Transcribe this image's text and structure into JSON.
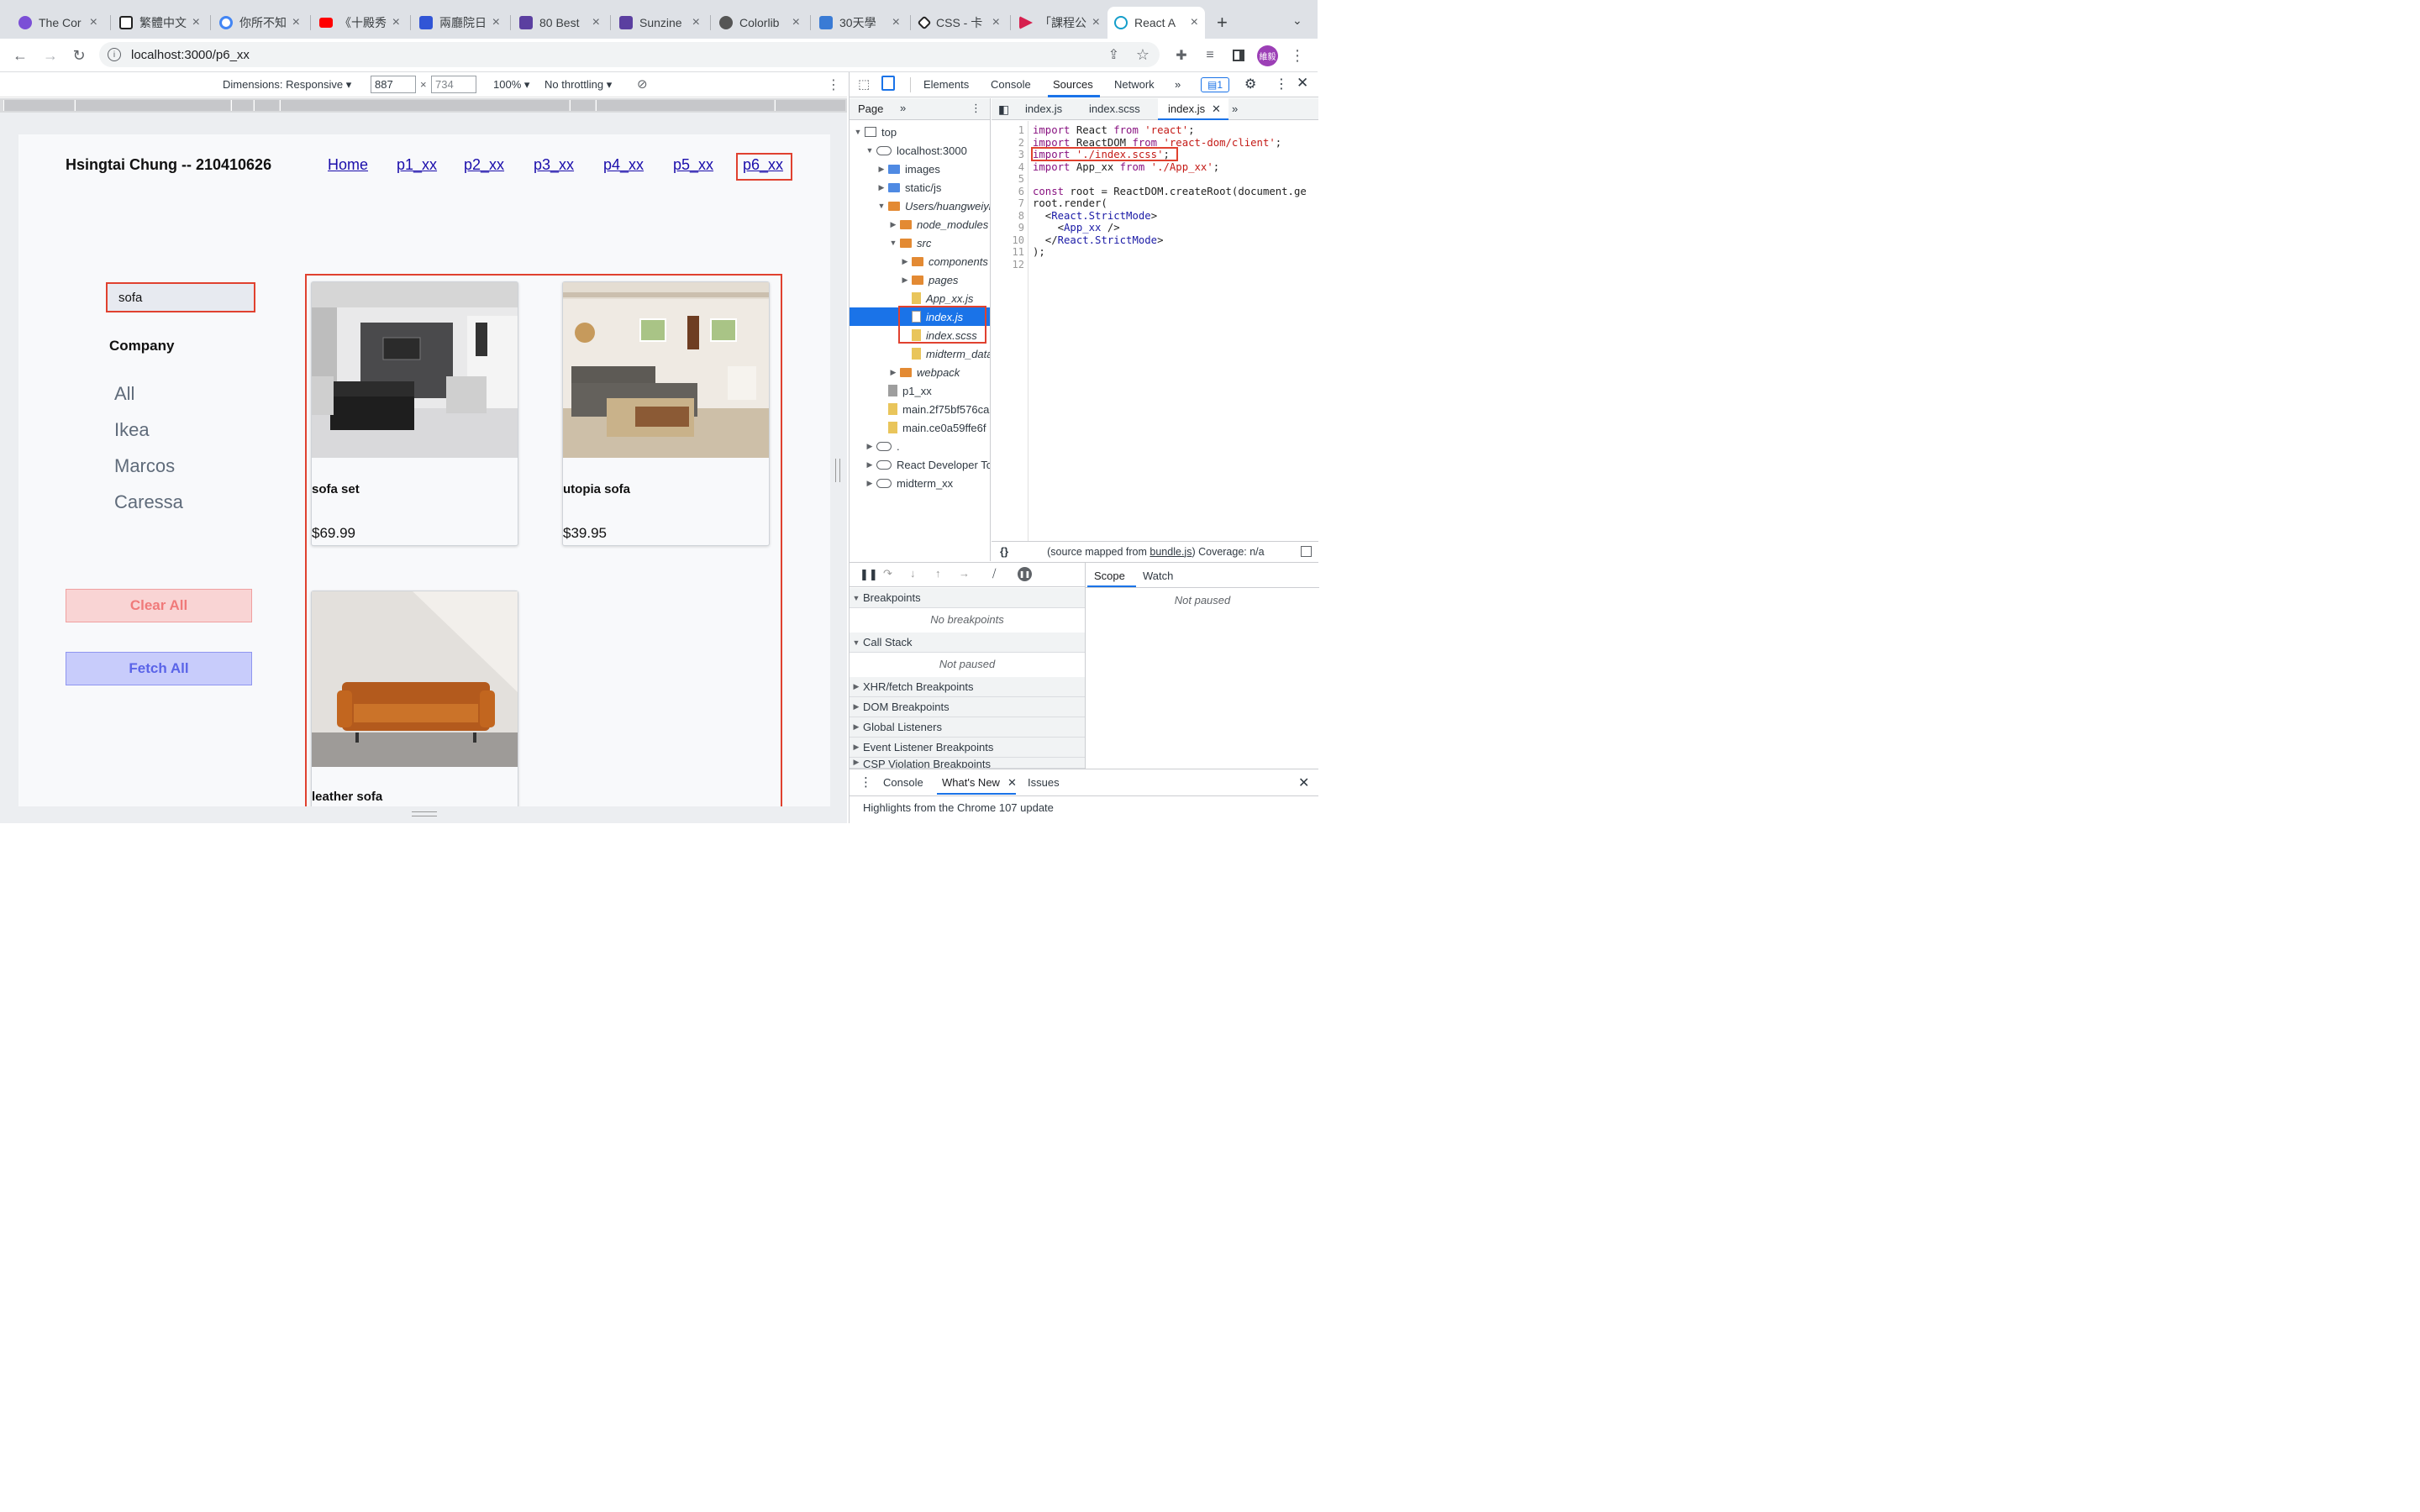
{
  "browser": {
    "tabs": [
      {
        "title": "The Cor",
        "color": "#7b4fd6"
      },
      {
        "title": "繁體中文",
        "color": "#222222"
      },
      {
        "title": "你所不知",
        "color": "#4285f4"
      },
      {
        "title": "《十殿秀",
        "color": "#ff0000"
      },
      {
        "title": "兩廳院日",
        "color": "#3155d6"
      },
      {
        "title": "80 Best",
        "color": "#5b3fa0"
      },
      {
        "title": "Sunzine",
        "color": "#5b3fa0"
      },
      {
        "title": "Colorlib",
        "color": "#555555"
      },
      {
        "title": "30天學",
        "color": "#3a7bd5"
      },
      {
        "title": "CSS - 卡",
        "color": "#222222"
      },
      {
        "title": "「課程公",
        "color": "#d6204e"
      },
      {
        "title": "React A",
        "color": "#149eca",
        "active": true
      }
    ],
    "new_tab": "+",
    "url": "localhost:3000/p6_xx",
    "profile": "維毅"
  },
  "device_toolbar": {
    "dimensions_label": "Dimensions: Responsive",
    "width": "887",
    "times": "×",
    "height": "734",
    "zoom": "100%",
    "throttle": "No throttling"
  },
  "page": {
    "brand": "Hsingtai Chung -- 210410626",
    "nav": [
      "Home",
      "p1_xx",
      "p2_xx",
      "p3_xx",
      "p4_xx",
      "p5_xx",
      "p6_xx"
    ],
    "search_value": "sofa",
    "company_heading": "Company",
    "companies": [
      "All",
      "Ikea",
      "Marcos",
      "Caressa"
    ],
    "clear_label": "Clear All",
    "fetch_label": "Fetch All",
    "products": [
      {
        "name": "sofa set",
        "price": "$69.99"
      },
      {
        "name": "utopia sofa",
        "price": "$39.95"
      },
      {
        "name": "leather sofa",
        "price": ""
      }
    ]
  },
  "devtools": {
    "tabs": [
      "Elements",
      "Console",
      "Sources",
      "Network"
    ],
    "issues_count": "1",
    "nav_tab": "Page",
    "tree": [
      "top",
      "localhost:3000",
      "images",
      "static/js",
      "Users/huangweiyi",
      "node_modules",
      "src",
      "components",
      "pages",
      "App_xx.js",
      "index.js",
      "index.scss",
      "midterm_data",
      "webpack",
      "p1_xx",
      "main.2f75bf576ca",
      "main.ce0a59ffe6f",
      ".",
      "React Developer Tools",
      "midterm_xx"
    ],
    "editor_tabs": [
      "index.js",
      "index.scss",
      "index.js"
    ],
    "line_numbers": [
      "1",
      "2",
      "3",
      "4",
      "5",
      "6",
      "7",
      "8",
      "9",
      "10",
      "11",
      "12"
    ],
    "code": {
      "l1a": "import",
      "l1b": " React ",
      "l1c": "from",
      "l1d": " 'react'",
      "l1e": ";",
      "l2a": "import",
      "l2b": " ReactDOM ",
      "l2c": "from",
      "l2d": " 'react-dom/client'",
      "l2e": ";",
      "l3a": "import",
      "l3b": " './index.scss'",
      "l3c": ";",
      "l4a": "import",
      "l4b": " App_xx ",
      "l4c": "from",
      "l4d": " './App_xx'",
      "l4e": ";",
      "l6a": "const",
      "l6b": " root = ReactDOM.createRoot(document.ge",
      "l7": "root.render(",
      "l8a": "  <",
      "l8b": "React.StrictMode",
      "l8c": ">",
      "l9a": "    <",
      "l9b": "App_xx",
      "l9c": " />",
      "l10a": "  </",
      "l10b": "React.StrictMode",
      "l10c": ">",
      "l11": ");"
    },
    "source_mapped": "(source mapped from ",
    "bundle": "bundle.js",
    "coverage": ")  Coverage: n/a",
    "breakpoints": "Breakpoints",
    "no_breakpoints": "No breakpoints",
    "call_stack": "Call Stack",
    "not_paused": "Not paused",
    "sections": [
      "XHR/fetch Breakpoints",
      "DOM Breakpoints",
      "Global Listeners",
      "Event Listener Breakpoints",
      "CSP Violation Breakpoints"
    ],
    "scope": "Scope",
    "watch": "Watch",
    "drawer_tabs": [
      "Console",
      "What's New",
      "Issues"
    ],
    "drawer_text": "Highlights from the Chrome 107 update"
  }
}
